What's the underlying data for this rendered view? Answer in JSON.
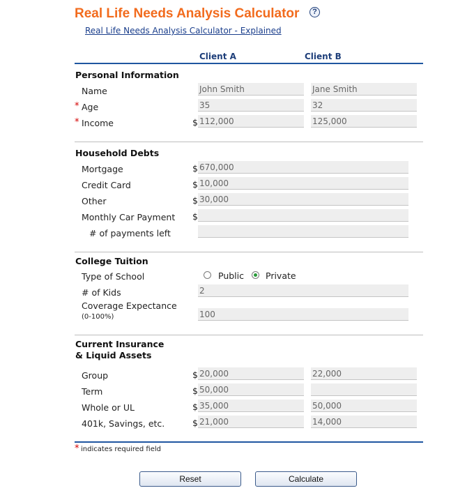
{
  "header": {
    "title": "Real Life Needs Analysis Calculator",
    "help_icon": "?",
    "explained_link": "Real Life Needs Analysis Calculator - Explained"
  },
  "columns": {
    "client_a": "Client A",
    "client_b": "Client B"
  },
  "personal": {
    "heading": "Personal Information",
    "name_label": "Name",
    "age_label": "Age",
    "income_label": "Income",
    "name_a": "John Smith",
    "name_b": "Jane Smith",
    "age_a": "35",
    "age_b": "32",
    "income_a": "112,000",
    "income_b": "125,000"
  },
  "debts": {
    "heading": "Household Debts",
    "mortgage_label": "Mortgage",
    "mortgage": "670,000",
    "credit_label": "Credit Card",
    "credit": "10,000",
    "other_label": "Other",
    "other": "30,000",
    "car_label": "Monthly Car Payment",
    "car": "",
    "payments_label": "# of payments left",
    "payments": ""
  },
  "college": {
    "heading": "College Tuition",
    "school_label": "Type of School",
    "public_label": "Public",
    "private_label": "Private",
    "selected": "Private",
    "kids_label": "# of Kids",
    "kids": "2",
    "coverage_label": "Coverage Expectance",
    "coverage_sub": "(0-100%)",
    "coverage": "100"
  },
  "insurance": {
    "heading_line1": "Current Insurance",
    "heading_line2": "& Liquid Assets",
    "group_label": "Group",
    "group_a": "20,000",
    "group_b": "22,000",
    "term_label": "Term",
    "term_a": "50,000",
    "term_b": "",
    "whole_label": "Whole or UL",
    "whole_a": "35,000",
    "whole_b": "50,000",
    "savings_label": "401k, Savings, etc.",
    "savings_a": "21,000",
    "savings_b": "14,000"
  },
  "symbols": {
    "required_star": "*",
    "dollar": "$"
  },
  "footer": {
    "required_note": "indicates required field",
    "reset_label": "Reset",
    "calculate_label": "Calculate"
  },
  "colors": {
    "title": "#f26b1d",
    "rule": "#1f56a0",
    "required": "#d40000"
  }
}
